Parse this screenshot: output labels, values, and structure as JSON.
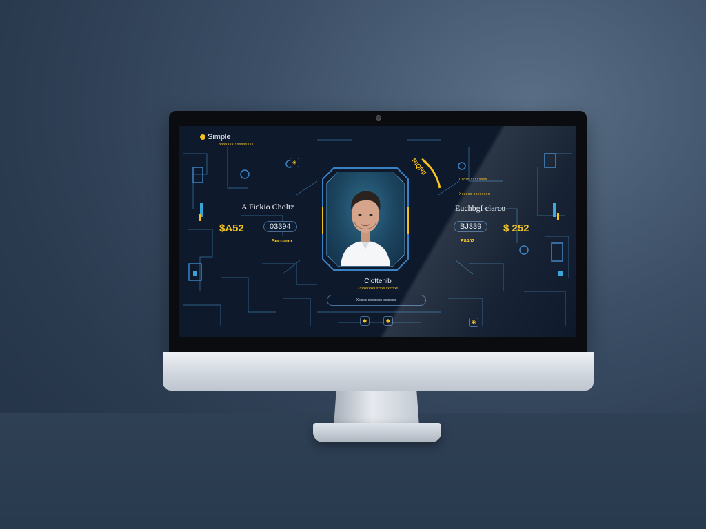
{
  "screen": {
    "brand": "Simple",
    "brand_tagline": "xxxxxxx xxxxxxxxx",
    "left": {
      "heading": "A Fickio Choltz",
      "price": "$A52",
      "pill_value": "03394",
      "sub_label": "Socoarcr"
    },
    "right": {
      "tag_1": "Croro xxxxxxxx",
      "tag_2": "Xxxxxx xxxxxxxx",
      "heading": "Euchbgf clarco",
      "pill_value": "BJ339",
      "price": "$ 252",
      "sub_label": "E8402"
    },
    "profile": {
      "name": "Clottenib",
      "subtitle": "Xxxxxxxxxx xxxxx xxxxxxx",
      "corner_badge": "RIQRII"
    },
    "search": {
      "text": "Xxxxxx xxxxxxxx xxxxxxxx"
    },
    "colors": {
      "accent": "#f4c21e",
      "screen_bg": "#0e1a2c",
      "circuit_line": "#2e5d84",
      "backdrop": "#2f4055"
    },
    "icons": [
      "brand-dot-icon",
      "bell-icon",
      "settings-icon",
      "gauge-icon",
      "chevron-icon"
    ]
  }
}
